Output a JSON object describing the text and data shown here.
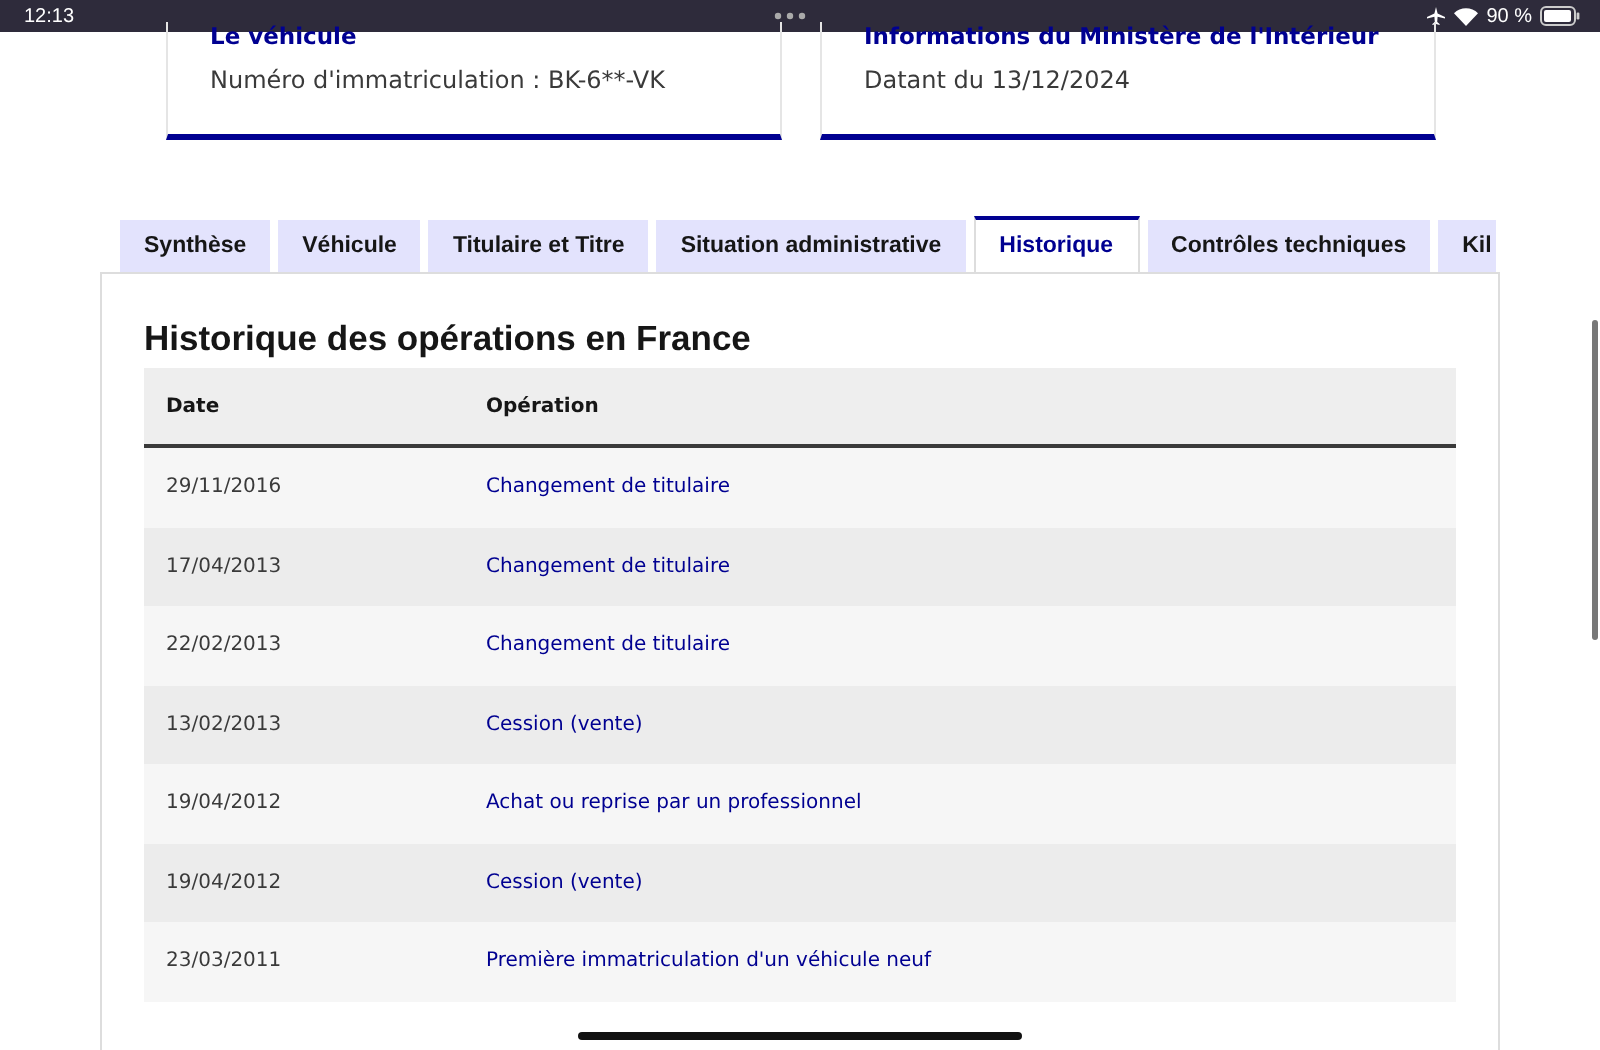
{
  "status_bar": {
    "time": "12:13",
    "battery_text": "90 %"
  },
  "cards": [
    {
      "title": "Le véhicule",
      "text": "Numéro d'immatriculation : BK-6**-VK"
    },
    {
      "title": "Informations du Ministère de l'Intérieur",
      "text": "Datant du 13/12/2024"
    }
  ],
  "tabs": [
    {
      "label": "Synthèse",
      "selected": false
    },
    {
      "label": "Véhicule",
      "selected": false
    },
    {
      "label": "Titulaire et Titre",
      "selected": false
    },
    {
      "label": "Situation administrative",
      "selected": false
    },
    {
      "label": "Historique",
      "selected": true
    },
    {
      "label": "Contrôles techniques",
      "selected": false
    },
    {
      "label": "Kil",
      "selected": false
    }
  ],
  "section_title": "Historique des opérations en France",
  "table": {
    "columns": [
      "Date",
      "Opération"
    ],
    "rows": [
      [
        "29/11/2016",
        "Changement de titulaire"
      ],
      [
        "17/04/2013",
        "Changement de titulaire"
      ],
      [
        "22/02/2013",
        "Changement de titulaire"
      ],
      [
        "13/02/2013",
        "Cession (vente)"
      ],
      [
        "19/04/2012",
        "Achat ou reprise par un professionnel"
      ],
      [
        "19/04/2012",
        "Cession (vente)"
      ],
      [
        "23/03/2011",
        "Première immatriculation d'un véhicule neuf"
      ]
    ]
  }
}
